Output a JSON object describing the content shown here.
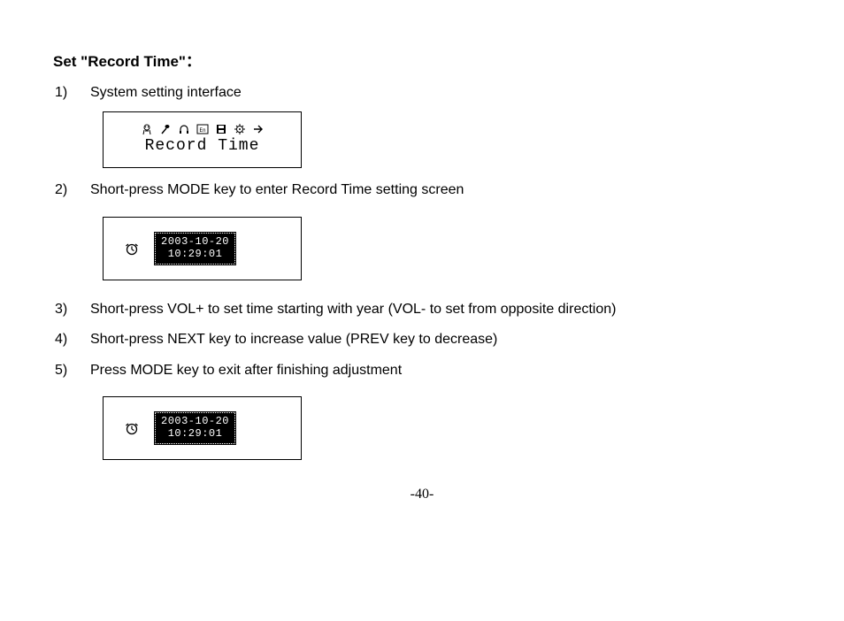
{
  "heading": "Set \"Record Time\"：",
  "steps": {
    "n1": "1)",
    "t1": "System setting interface",
    "n2": "2)",
    "t2": "Short-press MODE key to enter Record Time setting screen",
    "n3": "3)",
    "t3": "Short-press VOL+ to set time starting with year (VOL- to set from opposite direction)",
    "n4": "4)",
    "t4": "Short-press NEXT key to increase value (PREV key to decrease)",
    "n5": "5)",
    "t5": "Press MODE key to exit after finishing adjustment"
  },
  "lcd": {
    "menu_label": "Record Time",
    "date_line": "2003-10-20",
    "time_line": "10:29:01"
  },
  "page_number": "-40-"
}
